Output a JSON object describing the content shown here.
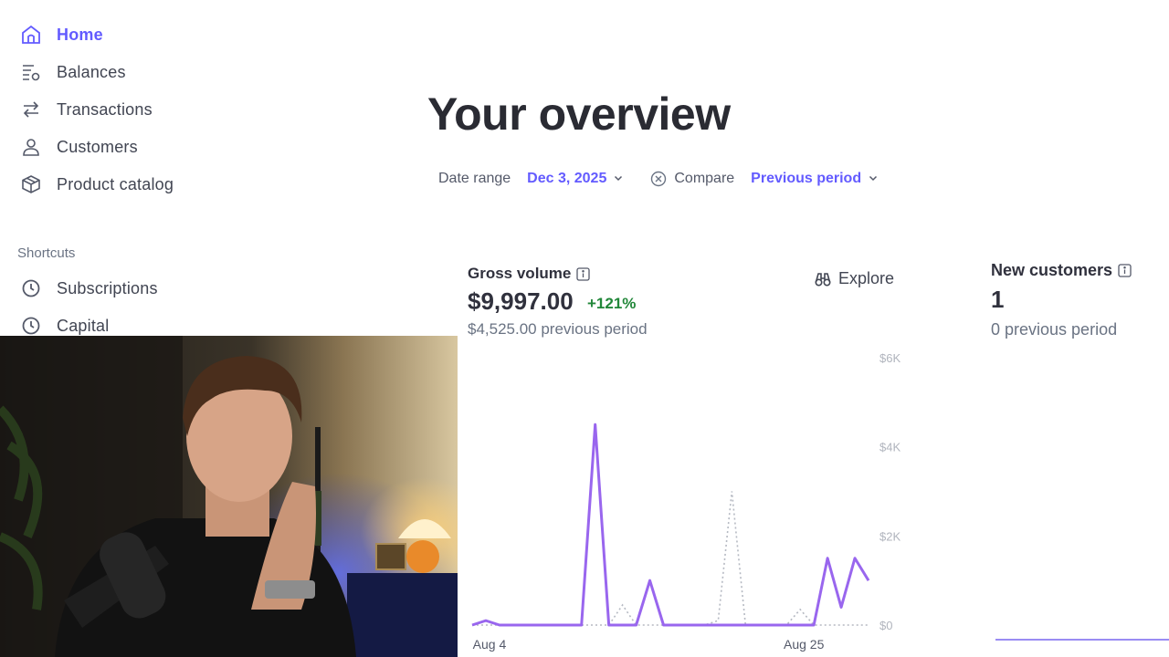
{
  "sidebar": {
    "items": [
      {
        "label": "Home",
        "icon": "home-icon",
        "active": true
      },
      {
        "label": "Balances",
        "icon": "balances-icon"
      },
      {
        "label": "Transactions",
        "icon": "transactions-icon"
      },
      {
        "label": "Customers",
        "icon": "customers-icon"
      },
      {
        "label": "Product catalog",
        "icon": "product-catalog-icon"
      }
    ],
    "shortcuts_title": "Shortcuts",
    "shortcuts": [
      {
        "label": "Subscriptions",
        "icon": "clock-icon"
      },
      {
        "label": "Capital",
        "icon": "clock-icon"
      }
    ]
  },
  "header": {
    "title": "Your overview",
    "date_range_label": "Date range",
    "date_range_value": "Dec 3, 2025",
    "compare_label": "Compare",
    "compare_value": "Previous period"
  },
  "gross_volume": {
    "title": "Gross volume",
    "value": "$9,997.00",
    "change": "+121%",
    "previous": "$4,525.00 previous period",
    "explore_label": "Explore"
  },
  "new_customers": {
    "title": "New customers",
    "value": "1",
    "previous": "0 previous period"
  },
  "colors": {
    "accent": "#635bff",
    "positive": "#218739",
    "current_series": "#9966ee",
    "previous_series": "#b5b9c2"
  },
  "chart_data": {
    "type": "line",
    "x_tick_labels": [
      "Aug 4",
      "Aug 25"
    ],
    "y_tick_labels": [
      "$6K",
      "$4K",
      "$2K",
      "$0"
    ],
    "ylim": [
      0,
      6000
    ],
    "x": [
      0,
      1,
      2,
      3,
      4,
      5,
      6,
      7,
      8,
      9,
      10,
      11,
      12,
      13,
      14,
      15,
      16,
      17,
      18,
      19,
      20,
      21,
      22,
      23,
      24,
      25,
      26,
      27,
      28,
      29
    ],
    "x_tick_index": [
      1,
      24
    ],
    "series": [
      {
        "values": [
          0,
          100,
          0,
          0,
          0,
          0,
          0,
          0,
          0,
          4500,
          0,
          0,
          0,
          1000,
          0,
          0,
          0,
          0,
          0,
          0,
          0,
          0,
          0,
          0,
          0,
          0,
          1500,
          400,
          1500,
          1000
        ]
      },
      {
        "values": [
          0,
          0,
          0,
          0,
          0,
          0,
          0,
          0,
          0,
          0,
          0,
          450,
          0,
          0,
          0,
          0,
          0,
          0,
          100,
          3000,
          0,
          0,
          0,
          0,
          350,
          0,
          0,
          0,
          0,
          0
        ]
      }
    ],
    "grid": false
  }
}
